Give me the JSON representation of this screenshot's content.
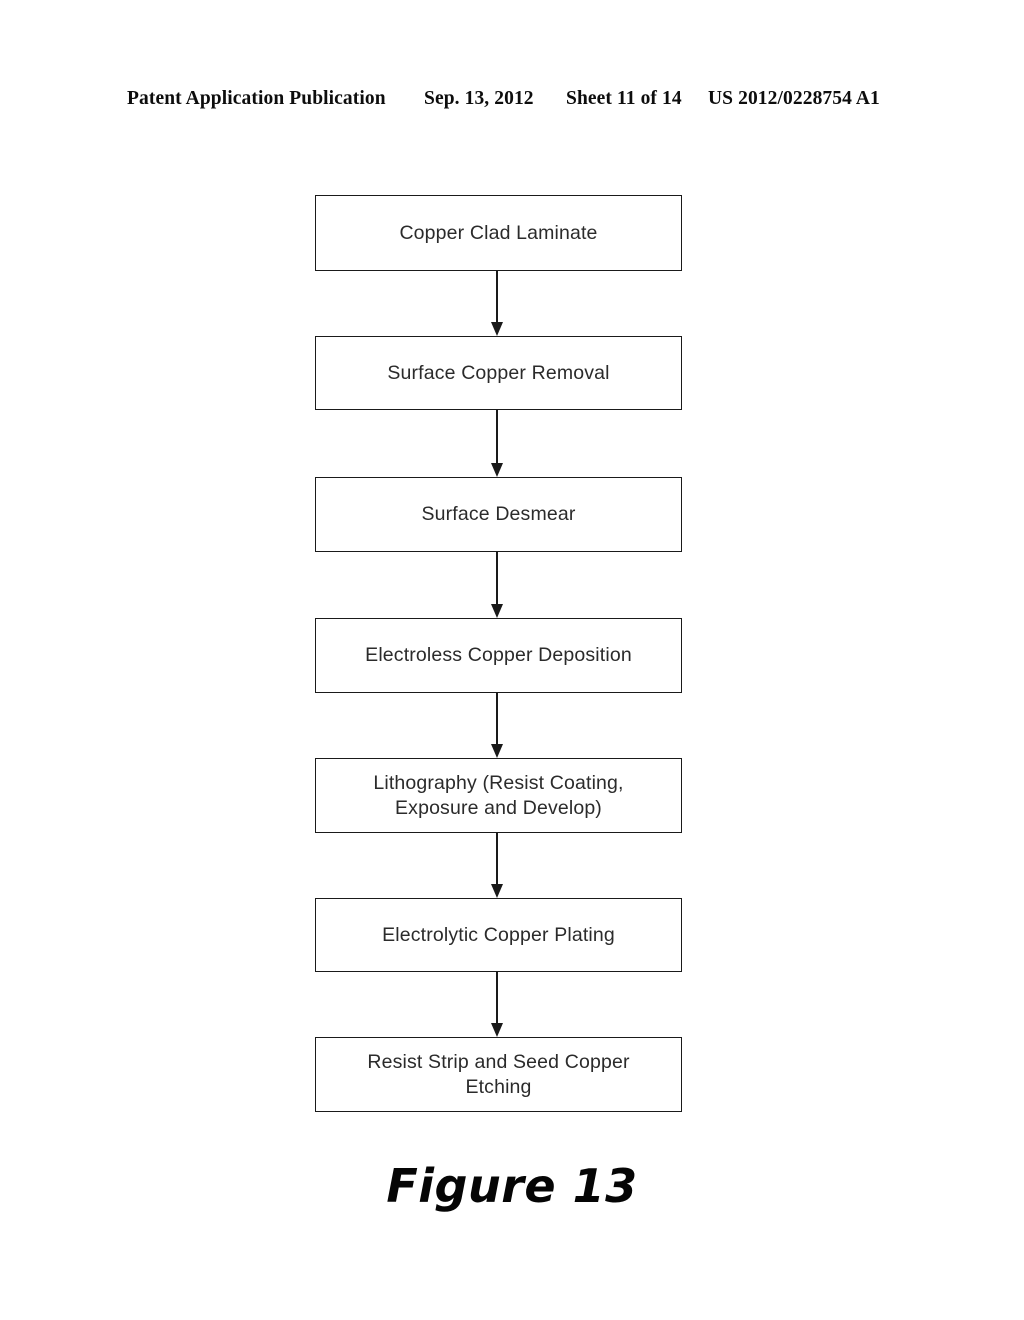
{
  "page": {
    "background_color": "#ffffff",
    "ink_color": "#1a1a1a"
  },
  "header": {
    "publication": "Patent Application Publication",
    "date": "Sep. 13, 2012",
    "sheet": "Sheet 11 of 14",
    "publication_number": "US 2012/0228754 A1"
  },
  "figure": {
    "caption": "Figure 13"
  },
  "chart_data": {
    "type": "diagram",
    "diagram_type": "flowchart",
    "title": "Figure 13",
    "orientation": "vertical",
    "nodes": [
      {
        "id": "n1",
        "label": "Copper Clad Laminate",
        "shape": "rectangle"
      },
      {
        "id": "n2",
        "label": "Surface Copper Removal",
        "shape": "rectangle"
      },
      {
        "id": "n3",
        "label": "Surface Desmear",
        "shape": "rectangle"
      },
      {
        "id": "n4",
        "label": "Electroless Copper Deposition",
        "shape": "rectangle"
      },
      {
        "id": "n5",
        "label": "Lithography (Resist Coating,\nExposure and Develop)",
        "shape": "rectangle"
      },
      {
        "id": "n6",
        "label": "Electrolytic Copper Plating",
        "shape": "rectangle"
      },
      {
        "id": "n7",
        "label": "Resist Strip and Seed Copper\nEtching",
        "shape": "rectangle"
      }
    ],
    "edges": [
      {
        "from": "n1",
        "to": "n2",
        "style": "solid-arrow-down"
      },
      {
        "from": "n2",
        "to": "n3",
        "style": "solid-arrow-down"
      },
      {
        "from": "n3",
        "to": "n4",
        "style": "solid-arrow-down"
      },
      {
        "from": "n4",
        "to": "n5",
        "style": "solid-arrow-down"
      },
      {
        "from": "n5",
        "to": "n6",
        "style": "solid-arrow-down"
      },
      {
        "from": "n6",
        "to": "n7",
        "style": "solid-arrow-down"
      }
    ]
  }
}
